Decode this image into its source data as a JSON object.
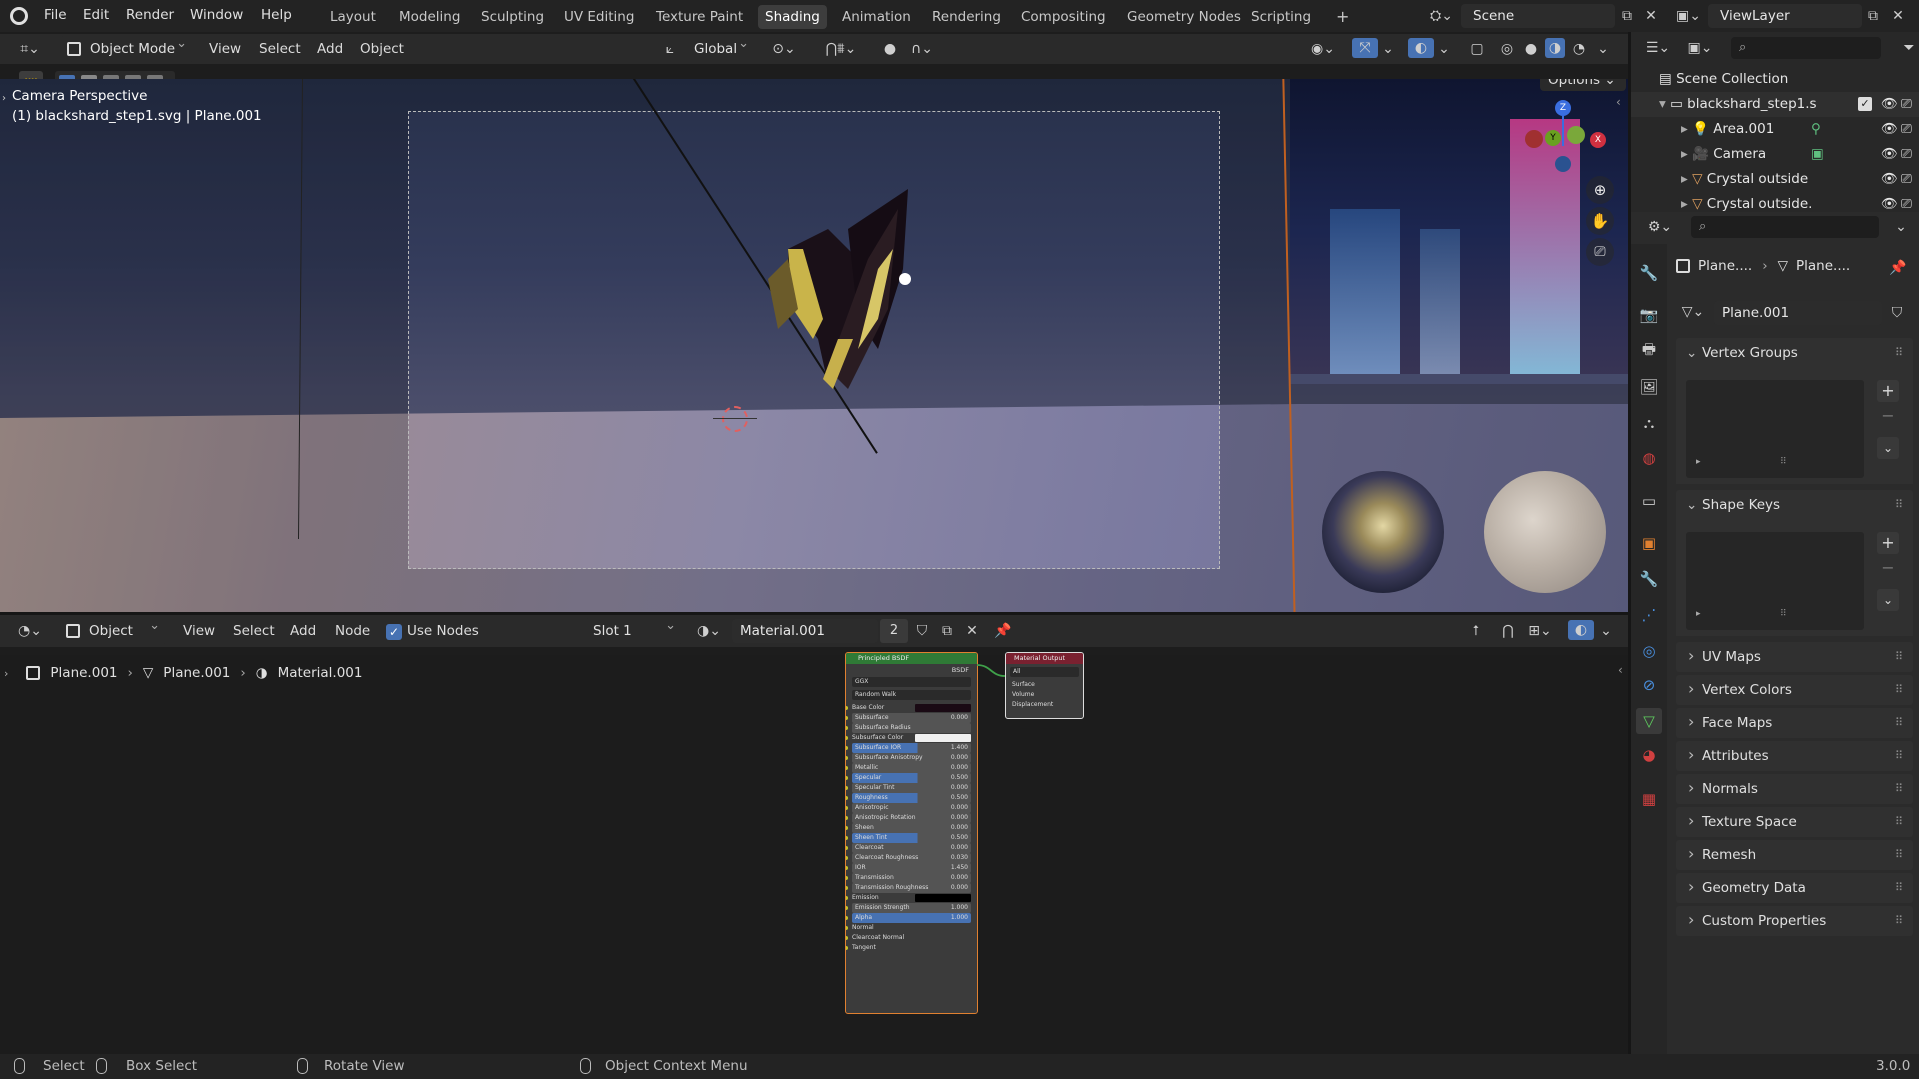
{
  "topbar": {
    "menus": [
      "File",
      "Edit",
      "Render",
      "Window",
      "Help"
    ],
    "workspaces": [
      "Layout",
      "Modeling",
      "Sculpting",
      "UV Editing",
      "Texture Paint",
      "Shading",
      "Animation",
      "Rendering",
      "Compositing",
      "Geometry Nodes",
      "Scripting"
    ],
    "active_workspace": "Shading",
    "add_tab": "+",
    "scene": "Scene",
    "view_layer": "ViewLayer"
  },
  "viewport": {
    "mode": "Object Mode",
    "menus": [
      "View",
      "Select",
      "Add",
      "Object"
    ],
    "transform_orientation": "Global",
    "options": "Options",
    "overlay_title": "Camera Perspective",
    "overlay_object": "(1) blackshard_step1.svg | Plane.001",
    "gizmo": {
      "z": "Z",
      "y": "Y",
      "x": "X"
    }
  },
  "node_editor": {
    "editor": "Object",
    "menus": [
      "View",
      "Select",
      "Add",
      "Node"
    ],
    "use_nodes_label": "Use Nodes",
    "use_nodes_checked": true,
    "slot": "Slot 1",
    "material": "Material.001",
    "users": "2",
    "breadcrumb": [
      "Plane.001",
      "Plane.001",
      "Material.001"
    ],
    "bsdf_node": {
      "title": "Principled BSDF",
      "output": "BSDF",
      "dist": "GGX",
      "sss": "Random Walk",
      "inputs": [
        {
          "label": "Base Color",
          "kind": "color",
          "color": "#1a0a14"
        },
        {
          "label": "Subsurface",
          "kind": "bar",
          "value": "0.000"
        },
        {
          "label": "Subsurface Radius",
          "kind": "bar",
          "value": ""
        },
        {
          "label": "Subsurface Color",
          "kind": "color",
          "color": "#f0f0f0"
        },
        {
          "label": "Subsurface IOR",
          "kind": "blue",
          "value": "1.400"
        },
        {
          "label": "Subsurface Anisotropy",
          "kind": "bar",
          "value": "0.000"
        },
        {
          "label": "Metallic",
          "kind": "bar",
          "value": "0.000"
        },
        {
          "label": "Specular",
          "kind": "blue",
          "value": "0.500"
        },
        {
          "label": "Specular Tint",
          "kind": "bar",
          "value": "0.000"
        },
        {
          "label": "Roughness",
          "kind": "blue",
          "value": "0.500"
        },
        {
          "label": "Anisotropic",
          "kind": "bar",
          "value": "0.000"
        },
        {
          "label": "Anisotropic Rotation",
          "kind": "bar",
          "value": "0.000"
        },
        {
          "label": "Sheen",
          "kind": "bar",
          "value": "0.000"
        },
        {
          "label": "Sheen Tint",
          "kind": "blue",
          "value": "0.500"
        },
        {
          "label": "Clearcoat",
          "kind": "bar",
          "value": "0.000"
        },
        {
          "label": "Clearcoat Roughness",
          "kind": "bar",
          "value": "0.030"
        },
        {
          "label": "IOR",
          "kind": "bar",
          "value": "1.450"
        },
        {
          "label": "Transmission",
          "kind": "bar",
          "value": "0.000"
        },
        {
          "label": "Transmission Roughness",
          "kind": "bar",
          "value": "0.000"
        },
        {
          "label": "Emission",
          "kind": "color",
          "color": "#000000"
        },
        {
          "label": "Emission Strength",
          "kind": "bar",
          "value": "1.000"
        },
        {
          "label": "Alpha",
          "kind": "full",
          "value": "1.000"
        },
        {
          "label": "Normal",
          "kind": "plain",
          "value": ""
        },
        {
          "label": "Clearcoat Normal",
          "kind": "plain",
          "value": ""
        },
        {
          "label": "Tangent",
          "kind": "plain",
          "value": ""
        }
      ]
    },
    "output_node": {
      "title": "Material Output",
      "target": "All",
      "inputs": [
        "Surface",
        "Volume",
        "Displacement"
      ]
    }
  },
  "outliner": {
    "root": "Scene Collection",
    "collection": "blackshard_step1.s",
    "items": [
      "Area.001",
      "Camera",
      "Crystal outside",
      "Crystal outside."
    ]
  },
  "properties": {
    "breadcrumb": [
      "Plane....",
      "Plane...."
    ],
    "mesh_name": "Plane.001",
    "open_panels": [
      "Vertex Groups",
      "Shape Keys"
    ],
    "panels": [
      "UV Maps",
      "Vertex Colors",
      "Face Maps",
      "Attributes",
      "Normals",
      "Texture Space",
      "Remesh",
      "Geometry Data",
      "Custom Properties"
    ]
  },
  "statusbar": {
    "items": [
      "Select",
      "Box Select",
      "Rotate View",
      "Object Context Menu"
    ],
    "version": "3.0.0"
  },
  "colors": {
    "accent": "#4772b3",
    "bsdf_header": "#2e7d32",
    "output_header": "#7a2130",
    "timeline_orange": "#e07020"
  }
}
